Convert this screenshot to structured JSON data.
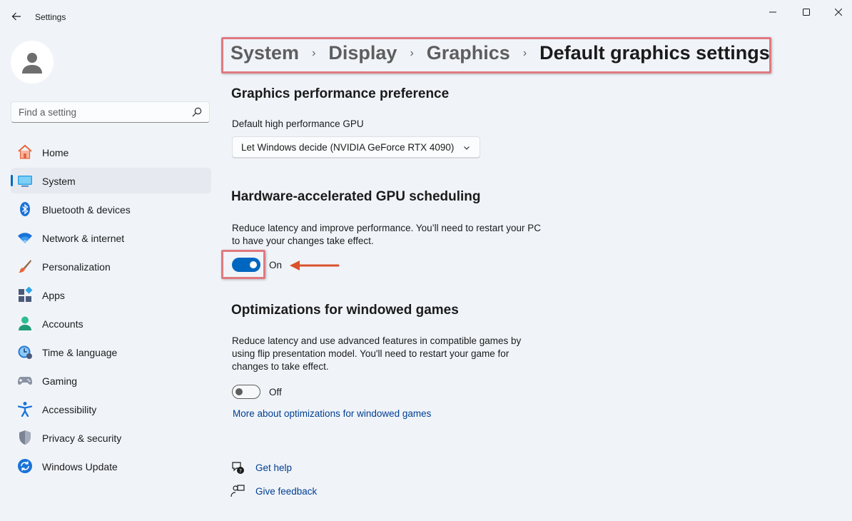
{
  "window": {
    "title": "Settings"
  },
  "search": {
    "placeholder": "Find a setting"
  },
  "sidebar": {
    "items": [
      {
        "label": "Home",
        "icon": "home-icon"
      },
      {
        "label": "System",
        "icon": "system-icon",
        "active": true
      },
      {
        "label": "Bluetooth & devices",
        "icon": "bluetooth-icon"
      },
      {
        "label": "Network & internet",
        "icon": "wifi-icon"
      },
      {
        "label": "Personalization",
        "icon": "brush-icon"
      },
      {
        "label": "Apps",
        "icon": "apps-icon"
      },
      {
        "label": "Accounts",
        "icon": "accounts-icon"
      },
      {
        "label": "Time & language",
        "icon": "time-language-icon"
      },
      {
        "label": "Gaming",
        "icon": "gamepad-icon"
      },
      {
        "label": "Accessibility",
        "icon": "accessibility-icon"
      },
      {
        "label": "Privacy & security",
        "icon": "shield-icon"
      },
      {
        "label": "Windows Update",
        "icon": "update-icon"
      }
    ]
  },
  "breadcrumb": {
    "items": [
      "System",
      "Display",
      "Graphics",
      "Default graphics settings"
    ]
  },
  "graphics_pref": {
    "heading": "Graphics performance preference",
    "gpu_label": "Default high performance GPU",
    "gpu_value": "Let Windows decide (NVIDIA GeForce RTX 4090)"
  },
  "hags": {
    "heading": "Hardware-accelerated GPU scheduling",
    "description_line1": "Reduce latency and improve performance. You’ll need to restart your PC",
    "description_line2": "to have your changes take effect.",
    "toggle_state": "On",
    "enabled": true
  },
  "windowed": {
    "heading": "Optimizations for windowed games",
    "description_line1": "Reduce latency and use advanced features in compatible games by",
    "description_line2": "using flip presentation model. You'll need to restart your game for",
    "description_line3": "changes to take effect.",
    "toggle_state": "Off",
    "enabled": false,
    "link": "More about optimizations for windowed games"
  },
  "footer": {
    "get_help": "Get help",
    "give_feedback": "Give feedback"
  },
  "colors": {
    "accent": "#0067c0",
    "highlight": "#e0797f",
    "arrow": "#d9522c"
  }
}
